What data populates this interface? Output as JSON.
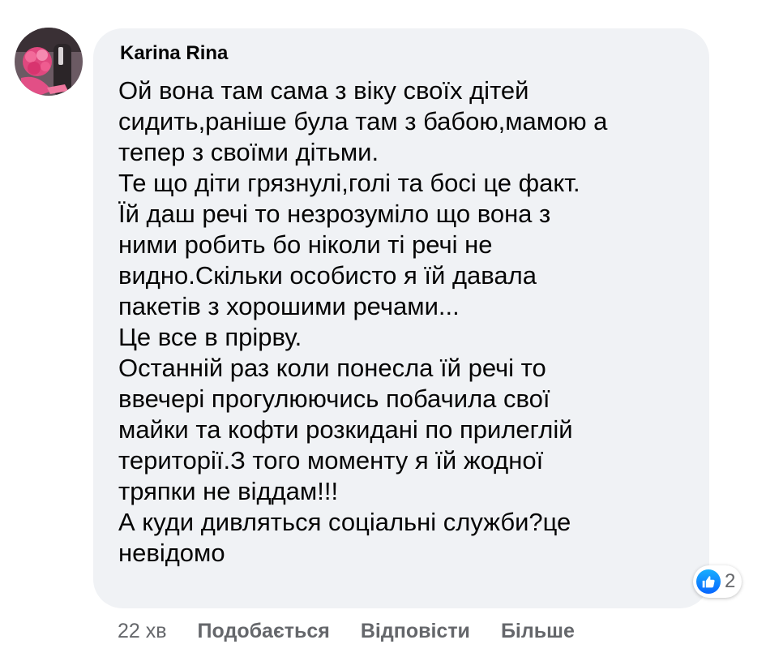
{
  "comment": {
    "author": "Karina Rina",
    "text_lines": [
      "Ой вона там сама з віку своїх дітей",
      "сидить,раніше була там з бабою,мамою а",
      "тепер з своїми дітьми.",
      "Те що діти грязнулі,голі та босі це факт.",
      "Їй даш речі то незрозуміло що вона з",
      "ними робить бо ніколи ті речі не",
      "видно.Скільки особисто я їй давала",
      "пакетів з хорошими речами...",
      "Це все в прірву.",
      "Останній раз коли понесла їй речі то",
      "ввечері прогулюючись побачила свої",
      "майки та кофти розкидані по прилеглій",
      "території.З того моменту я їй жодної",
      "тряпки не віддам!!!",
      "А куди дивляться соціальні служби?це",
      "невідомо"
    ],
    "reaction_icon": "like-icon",
    "reaction_count": "2",
    "timestamp": "22 хв",
    "actions": {
      "like": "Подобається",
      "reply": "Відповісти",
      "more": "Більше"
    }
  },
  "colors": {
    "bubble": "#f0f2f5",
    "text": "#050505",
    "secondary": "#65676b",
    "like_blue": "#0866ff"
  }
}
